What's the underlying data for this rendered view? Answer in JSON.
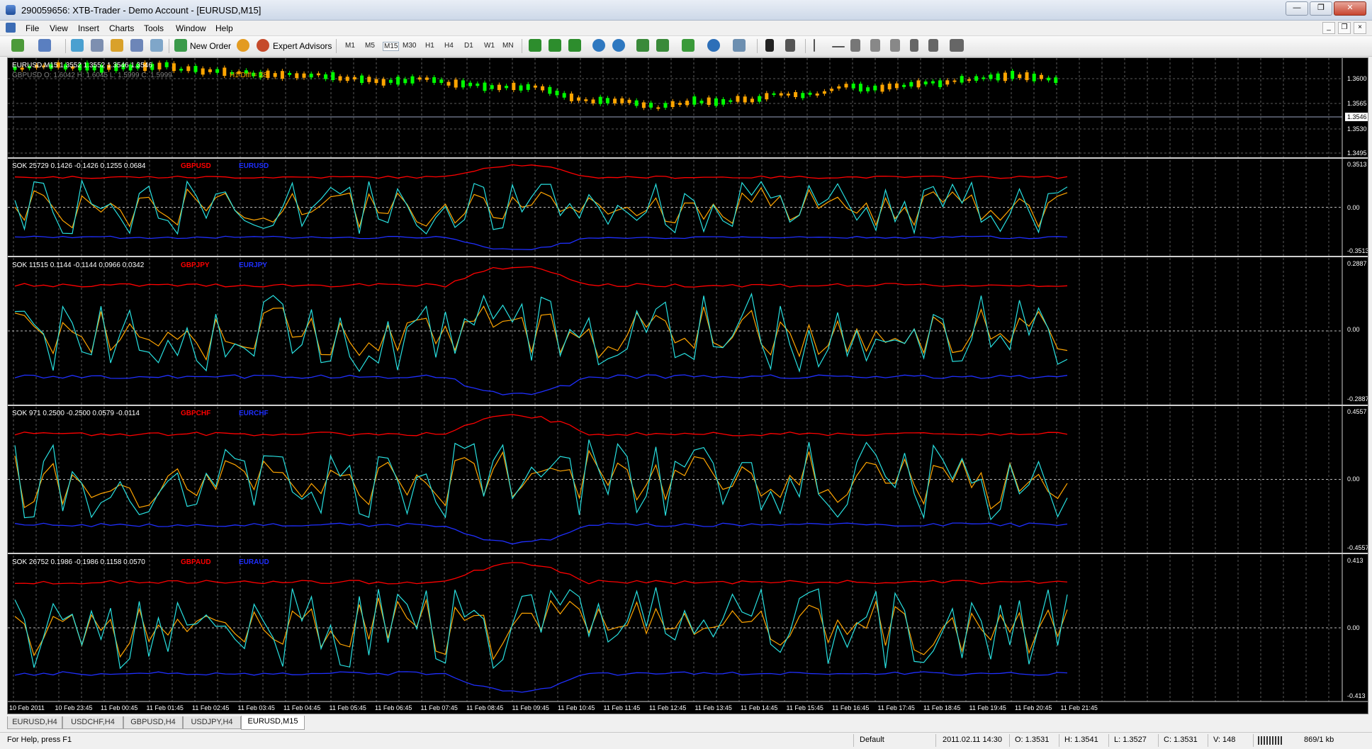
{
  "window": {
    "title": "290059656: XTB-Trader - Demo Account - [EURUSD,M15]",
    "min_label": "—",
    "max_label": "❐",
    "close_label": "✕"
  },
  "menu": [
    "File",
    "View",
    "Insert",
    "Charts",
    "Tools",
    "Window",
    "Help"
  ],
  "mdi": {
    "min": "_",
    "restore": "❐",
    "close": "×"
  },
  "toolbar": {
    "new_order": "New Order",
    "expert_advisors": "Expert Advisors",
    "timeframes": [
      "M1",
      "M5",
      "M15",
      "M30",
      "H1",
      "H4",
      "D1",
      "W1",
      "MN"
    ]
  },
  "chart": {
    "main": {
      "info": "EURUSD,M15  1.3552 1.3552 1.3546 1.3546",
      "overlay_info": "GBPUSD O: 1.6042  H: 1.6045  L: 1.5999  C: 1.5999",
      "h1_diff": "H1 Diff = 28",
      "price_levels": [
        "1.3600",
        "1.3565",
        "1.3546",
        "1.3530",
        "1.3495"
      ],
      "current_price": "1.3546"
    },
    "panels": [
      {
        "info": "SOK 25729 0.1426 -0.1426 0.1255 0.0684",
        "red_label": "GBPUSD",
        "blue_label": "EURUSD",
        "top": "0.3513",
        "mid": "0.00",
        "bottom": "-0.3513"
      },
      {
        "info": "SOK 11515 0.1144 -0.1144 0.0966 0.0342",
        "red_label": "GBPJPY",
        "blue_label": "EURJPY",
        "top": "0.2887",
        "mid": "0.00",
        "bottom": "-0.2887"
      },
      {
        "info": "SOK 971 0.2500 -0.2500 0.0579 -0.0114",
        "red_label": "GBPCHF",
        "blue_label": "EURCHF",
        "top": "0.4557",
        "mid": "0.00",
        "bottom": "-0.4557"
      },
      {
        "info": "SOK 26752 0.1986 -0.1986 0.1158 0.0570",
        "red_label": "GBPAUD",
        "blue_label": "EURAUD",
        "top": "0.413",
        "mid": "0.00",
        "bottom": "-0.413"
      }
    ],
    "time_labels": [
      "10 Feb 2011",
      "10 Feb 23:45",
      "11 Feb 00:45",
      "11 Feb 01:45",
      "11 Feb 02:45",
      "11 Feb 03:45",
      "11 Feb 04:45",
      "11 Feb 05:45",
      "11 Feb 06:45",
      "11 Feb 07:45",
      "11 Feb 08:45",
      "11 Feb 09:45",
      "11 Feb 10:45",
      "11 Feb 11:45",
      "11 Feb 12:45",
      "11 Feb 13:45",
      "11 Feb 14:45",
      "11 Feb 15:45",
      "11 Feb 16:45",
      "11 Feb 17:45",
      "11 Feb 18:45",
      "11 Feb 19:45",
      "11 Feb 20:45",
      "11 Feb 21:45"
    ],
    "colors": {
      "bg": "#000000",
      "grid": "#5a5a5a",
      "bull": "#00ff00",
      "bear": "#ffa500",
      "red": "#ff0000",
      "blue": "#1f2fff",
      "cyan": "#28e0e0",
      "orange": "#ffa500"
    }
  },
  "tabs": [
    "EURUSD,H4",
    "USDCHF,H4",
    "GBPUSD,H4",
    "USDJPY,H4",
    "EURUSD,M15"
  ],
  "active_tab": "EURUSD,M15",
  "status": {
    "help": "For Help, press F1",
    "profile": "Default",
    "datetime": "2011.02.11 14:30",
    "open": "O: 1.3531",
    "high": "H: 1.3541",
    "low": "L: 1.3527",
    "close": "C: 1.3531",
    "volume": "V: 148",
    "traffic": "869/1 kb"
  }
}
